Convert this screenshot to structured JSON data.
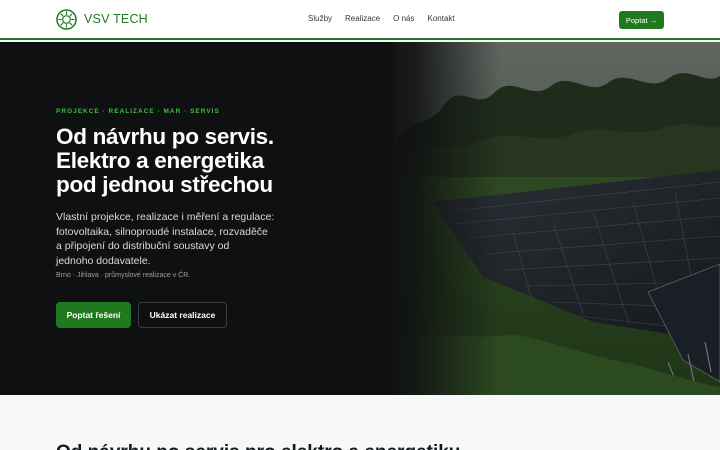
{
  "header": {
    "brand_prefix": "VSV",
    "brand_name": "TECH",
    "logo_icon": "solar-grid-icon",
    "nav": [
      {
        "label": "Služby"
      },
      {
        "label": "Realizace"
      },
      {
        "label": "O nás"
      },
      {
        "label": "Kontakt"
      }
    ],
    "cta_label": "Poptat →"
  },
  "hero": {
    "eyebrow": "PROJEKCE · REALIZACE · MAR · SERVIS",
    "title_lines": [
      "Od návrhu po servis.",
      "Elektro a energetika",
      "pod jednou střechou"
    ],
    "lead_lines": [
      "Vlastní projekce, realizace i měření a regulace:",
      "fotovoltaika, silnoproudé instalace, rozvaděče",
      "a připojení do distribuční soustavy od",
      "jednoho dodavatele."
    ],
    "meta": "Brno · Jihlava · průmyslové realizace v ČR.",
    "primary_button": "Poptat řešení",
    "secondary_button": "Ukázat realizace"
  },
  "next_section": {
    "title": "Od návrhu po servis pro elektro a energetiku"
  },
  "colors": {
    "brand_green": "#1f7a1f",
    "eyebrow_green": "#3fbf3f",
    "hero_bg": "#0f1011",
    "section_bg": "#f6f7f8"
  }
}
